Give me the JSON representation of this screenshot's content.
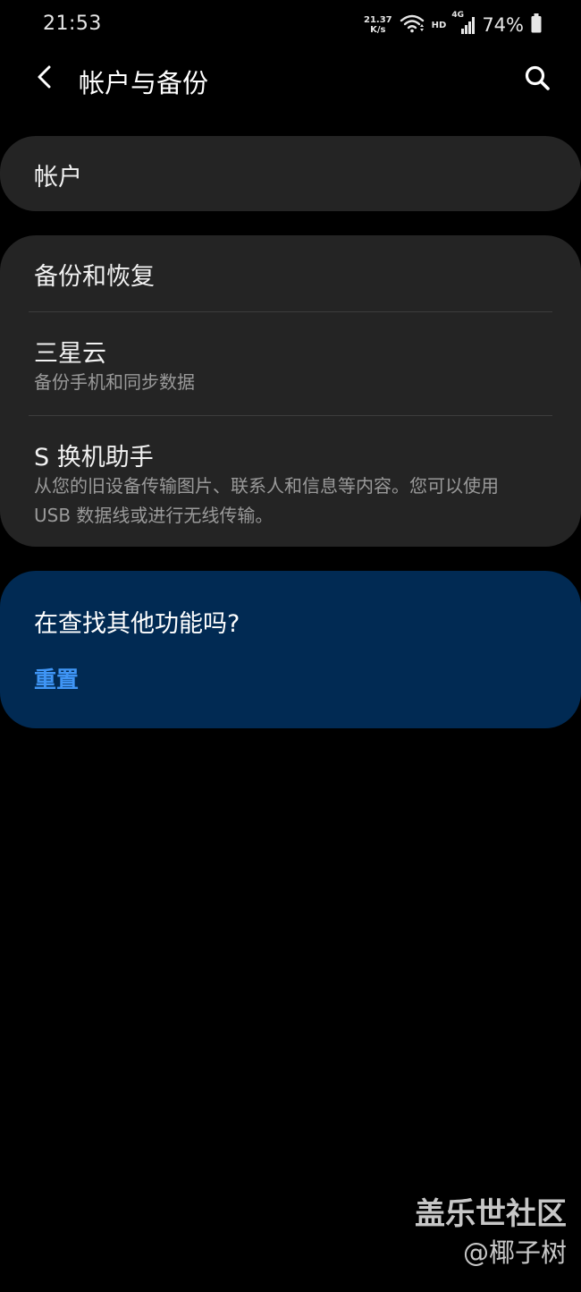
{
  "status_bar": {
    "time": "21:53",
    "net_speed_value": "21.37",
    "net_speed_unit": "K/s",
    "hd_label": "HD",
    "network_type": "4G",
    "battery": "74%"
  },
  "header": {
    "title": "帐户与备份"
  },
  "accounts_card": {
    "title": "帐户"
  },
  "backup_card": {
    "items": [
      {
        "title": "备份和恢复"
      },
      {
        "title": "三星云",
        "subtitle": "备份手机和同步数据"
      },
      {
        "title": "S 换机助手",
        "subtitle": "从您的旧设备传输图片、联系人和信息等内容。您可以使用 USB 数据线或进行无线传输。"
      }
    ]
  },
  "promo_card": {
    "title": "在查找其他功能吗?",
    "link": "重置"
  },
  "watermark": {
    "brand": "盖乐世社区",
    "user": "@椰子树"
  },
  "colors": {
    "background": "#000000",
    "card": "#242424",
    "promo_card": "#012a53",
    "link": "#3f95f5"
  }
}
